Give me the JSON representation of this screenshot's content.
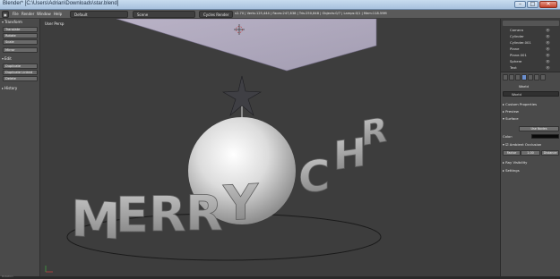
{
  "window": {
    "title": "Blender* [C:\\Users\\Adrian\\Downloads\\star.blend]",
    "min_glyph": "–",
    "max_glyph": "□",
    "close_glyph": "✕"
  },
  "header": {
    "menus": [
      "File",
      "Render",
      "Window",
      "Help"
    ],
    "layout": "Default",
    "scene": "Scene",
    "engine": "Cycles Render",
    "stats": "v2.70 | Verts:125,444 | Faces:247,838 | Tris:250,848 | Objects:0/7 | Lamps:0/1 | Mem:118.59M"
  },
  "toolshelf": {
    "transform_label": "Transform",
    "transform_buttons": [
      "Translate",
      "Rotate",
      "Scale",
      "Mirror"
    ],
    "edit_label": "Edit",
    "edit_buttons": [
      "Duplicate",
      "Duplicate Linked",
      "Delete"
    ],
    "history_label": "History"
  },
  "viewport": {
    "label": "User Persp"
  },
  "outliner": {
    "items": [
      "Camera",
      "Cylinder",
      "Cylinder.001",
      "Plane",
      "Plane.001",
      "Sphere",
      "Text"
    ]
  },
  "properties": {
    "world_name": "World",
    "world_field": "World",
    "sections": {
      "custom_properties": "Custom Properties",
      "preview": "Preview",
      "surface": "Surface",
      "ray_visibility": "Ray Visibility",
      "settings": "Settings"
    },
    "use_nodes_button": "Use Nodes",
    "color_label": "Color:",
    "ambient_occlusion": "Ambient Occlusion",
    "ao_buttons": [
      "Factor",
      "1.00",
      "Distance"
    ]
  },
  "statusbar": {
    "label": "Rotation"
  },
  "colors": {
    "viewport_bg": "#3d3d3d",
    "active_tab": "#6b8fcf",
    "title_bar": "#b7cde5"
  }
}
